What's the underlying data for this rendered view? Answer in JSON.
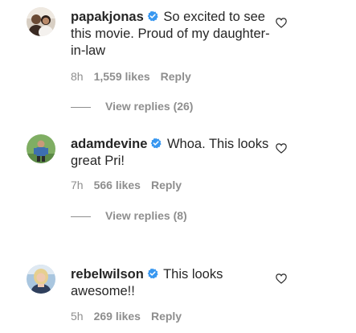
{
  "comments": [
    {
      "username": "papakjonas",
      "text": "So excited to see this movie. Proud of my daughter-in-law",
      "time": "8h",
      "likes": "1,559 likes",
      "reply": "Reply",
      "view_replies": "View replies (26)"
    },
    {
      "username": "adamdevine",
      "text": "Whoa. This looks great Pri!",
      "time": "7h",
      "likes": "566 likes",
      "reply": "Reply",
      "view_replies": "View replies (8)"
    },
    {
      "username": "rebelwilson",
      "text": "This looks awesome!!",
      "time": "5h",
      "likes": "269 likes",
      "reply": "Reply"
    }
  ],
  "colors": {
    "text": "#262626",
    "muted": "#8e8e8e",
    "verified": "#3897f0"
  },
  "icons": [
    "verified-badge-icon",
    "heart-outline-icon"
  ]
}
